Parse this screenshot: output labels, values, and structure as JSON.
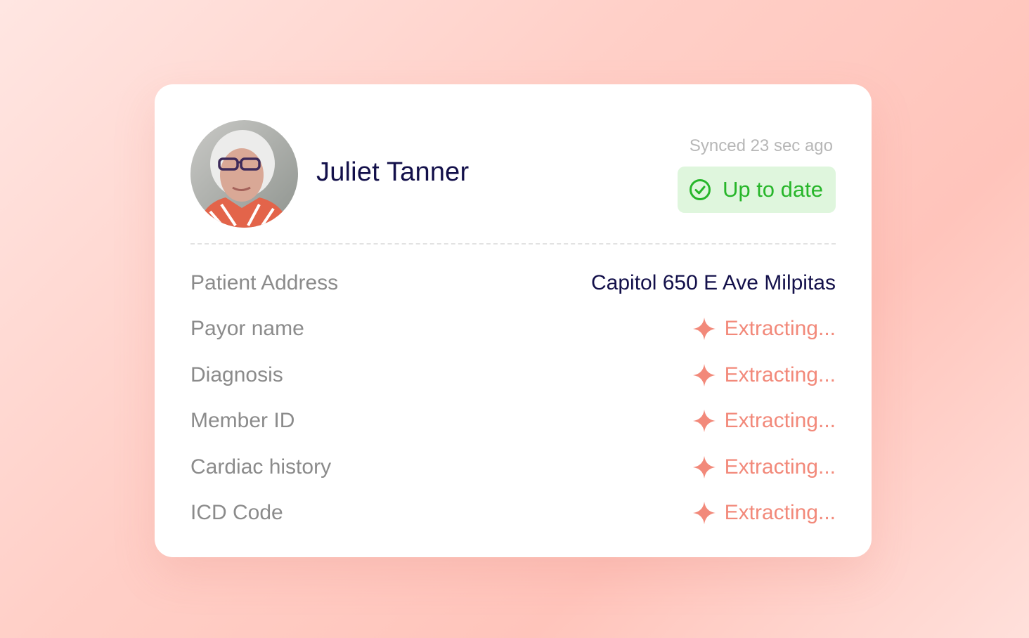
{
  "patient": {
    "name": "Juliet Tanner",
    "avatar_icon": "patient-photo"
  },
  "sync": {
    "synced_text": "Synced 23 sec ago",
    "status_label": "Up to date",
    "status_icon": "check-circle-icon",
    "status_color": "#27b62a",
    "status_bg": "#dff6dd"
  },
  "fields": [
    {
      "label": "Patient Address",
      "value": "Capitol 650 E Ave Milpitas",
      "state": "filled"
    },
    {
      "label": "Payor name",
      "value": "Extracting...",
      "state": "extracting"
    },
    {
      "label": "Diagnosis",
      "value": "Extracting...",
      "state": "extracting"
    },
    {
      "label": "Member ID",
      "value": "Extracting...",
      "state": "extracting"
    },
    {
      "label": "Cardiac history",
      "value": "Extracting...",
      "state": "extracting"
    },
    {
      "label": "ICD Code",
      "value": "Extracting...",
      "state": "extracting"
    }
  ],
  "colors": {
    "accent": "#f2897a",
    "title": "#13104a",
    "label": "#8b8b8b"
  }
}
